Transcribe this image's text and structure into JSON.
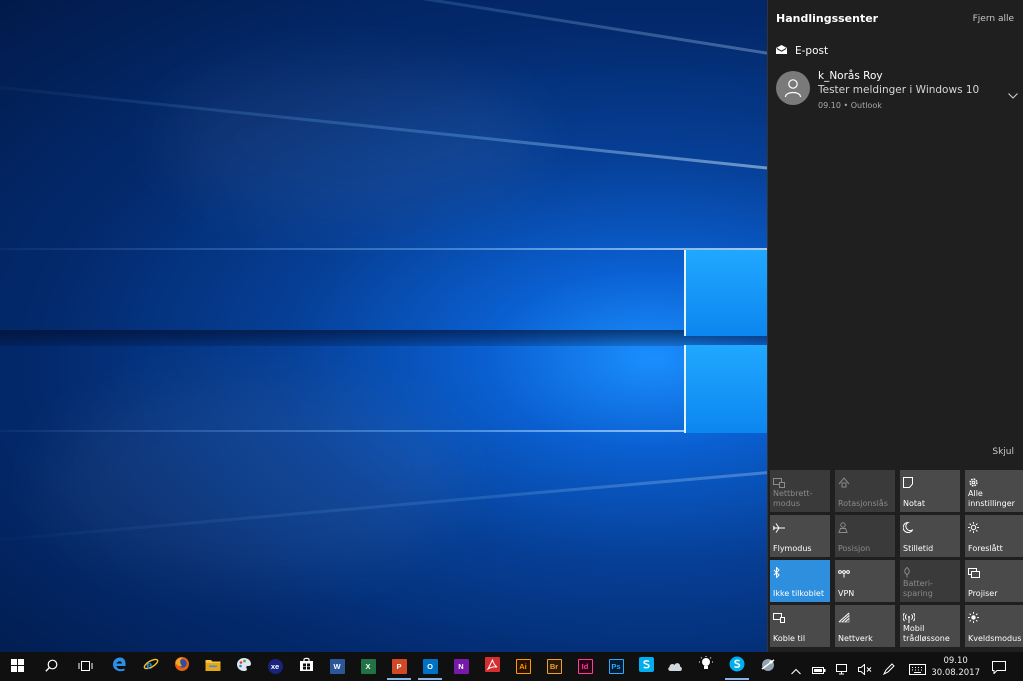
{
  "action_center": {
    "title": "Handlingssenter",
    "clear_all": "Fjern alle",
    "group_name": "E-post",
    "notification": {
      "sender": "k_Norås Roy",
      "body": "Tester meldinger i Windows 10",
      "meta": "09.10 • Outlook"
    },
    "collapse": "Skjul"
  },
  "quick_actions": {
    "tablet_mode": "Nettbrett-\nmodus",
    "rotation_lock": "Rotasjonslås",
    "note": "Notat",
    "all_settings": "Alle\ninnstillinger",
    "airplane": "Flymodus",
    "location": "Posisjon",
    "quiet_hours": "Stilletid",
    "suggested": "Foreslått",
    "bluetooth": "Ikke tilkoblet",
    "vpn": "VPN",
    "battery_saver": "Batteri-\nsparing",
    "project": "Projiser",
    "connect": "Koble til",
    "network": "Nettverk",
    "mobile_hotspot": "Mobil\ntrådløssone",
    "night_light": "Kveldsmodus"
  },
  "taskbar": {
    "apps": {
      "xe": "xe",
      "word": "W",
      "excel": "X",
      "powerpoint": "P",
      "outlook": "O",
      "onenote": "N",
      "illustrator": "Ai",
      "bridge": "Br",
      "indesign": "Id",
      "photoshop": "Ps"
    },
    "time": "09.10",
    "date": "30.08.2017"
  },
  "colors": {
    "action_center_bg": "#1f1f1f",
    "tile_bg": "#4a4a4a",
    "tile_active": "#2d8fdd",
    "taskbar_bg": "#101010"
  }
}
